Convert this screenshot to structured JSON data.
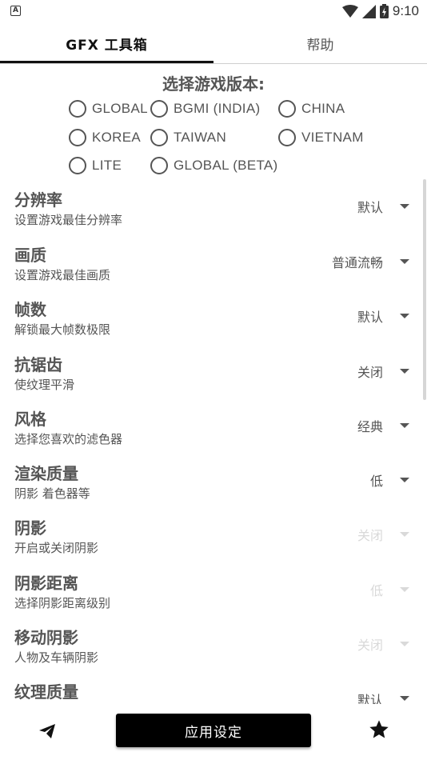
{
  "status_bar": {
    "notification_icon": "A",
    "time": "9:10",
    "icons": [
      "wifi-icon",
      "signal-icon",
      "battery-icon"
    ]
  },
  "tabs": [
    {
      "label": "GFX 工具箱",
      "selected": true
    },
    {
      "label": "帮助",
      "selected": false
    }
  ],
  "version": {
    "title": "选择游戏版本:",
    "options": [
      "GLOBAL",
      "BGMI (INDIA)",
      "CHINA",
      "KOREA",
      "TAIWAN",
      "VIETNAM",
      "LITE",
      "GLOBAL (BETA)"
    ]
  },
  "settings": [
    {
      "title": "分辨率",
      "subtitle": "设置游戏最佳分辨率",
      "value": "默认",
      "enabled": true
    },
    {
      "title": "画质",
      "subtitle": "设置游戏最佳画质",
      "value": "普通流畅",
      "enabled": true
    },
    {
      "title": "帧数",
      "subtitle": "解锁最大帧数极限",
      "value": "默认",
      "enabled": true
    },
    {
      "title": "抗锯齿",
      "subtitle": "使纹理平滑",
      "value": "关闭",
      "enabled": true
    },
    {
      "title": "风格",
      "subtitle": "选择您喜欢的滤色器",
      "value": "经典",
      "enabled": true
    },
    {
      "title": "渲染质量",
      "subtitle": "阴影 着色器等",
      "value": "低",
      "enabled": true
    },
    {
      "title": "阴影",
      "subtitle": "开启或关闭阴影",
      "value": "关闭",
      "enabled": false
    },
    {
      "title": "阴影距离",
      "subtitle": "选择阴影距离级别",
      "value": "低",
      "enabled": false
    },
    {
      "title": "移动阴影",
      "subtitle": "人物及车辆阴影",
      "value": "关闭",
      "enabled": false
    },
    {
      "title": "纹理质量",
      "subtitle": "",
      "value": "默认",
      "enabled": true
    }
  ],
  "bottom": {
    "apply_label": "应用设定",
    "left_icon": "telegram-send-icon",
    "right_icon": "star-icon"
  }
}
